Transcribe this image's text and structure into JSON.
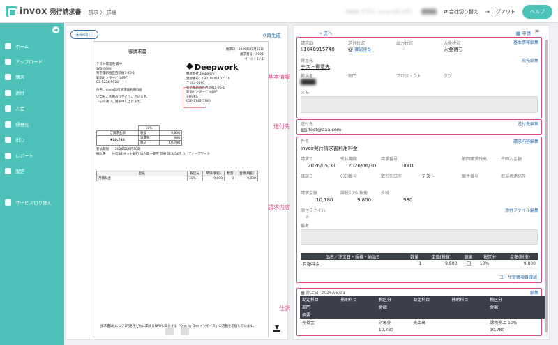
{
  "header": {
    "logo": "invox",
    "app_name": "発行請求書",
    "breadcrumb_root": "請求",
    "breadcrumb_sep": "〉",
    "breadcrumb_current": "詳細",
    "company_blur": "invox アプリ（ショッピング）",
    "user_blur": "████",
    "switch_company": "会社切り替え",
    "logout": "ログアウト",
    "help": "ヘルプ"
  },
  "sidebar": {
    "items": [
      {
        "label": "ホーム",
        "icon": "home-icon"
      },
      {
        "label": "アップロード",
        "icon": "upload-icon"
      },
      {
        "label": "請求",
        "icon": "invoice-icon"
      },
      {
        "label": "送付",
        "icon": "send-icon"
      },
      {
        "label": "入金",
        "icon": "deposit-icon"
      },
      {
        "label": "得意先",
        "icon": "client-icon"
      },
      {
        "label": "出力",
        "icon": "output-icon"
      },
      {
        "label": "レポート",
        "icon": "report-icon"
      },
      {
        "label": "設定",
        "icon": "settings-icon"
      },
      {
        "label": "サービス切り替え",
        "icon": "switch-icon"
      }
    ]
  },
  "doc": {
    "status_badge": "未申請",
    "regen": "再生成",
    "paper": {
      "title": "御請求書",
      "date": "請求日：2026年05月31日",
      "number": "請求番号：0001",
      "page": "ページ：1 / 1",
      "to": "テスト得意先 御中",
      "to_zip": "163-0690",
      "to_addr1": "東京都新宿区西新宿1-25-1",
      "to_addr2": "新宿センタービル49F",
      "to_tel": "03-1234-5678",
      "subject": "件名：invox発行請求書利用料金",
      "greet1": "いつもご利用ありがとうございます。",
      "greet2": "下記の通りご請求申し上げます。",
      "logo": "Deepwork",
      "co_name": "株式会社Deepwork",
      "co_reg": "登録番号：T9010401102110",
      "co_zip": "〒163-0690",
      "co_addr": "東京都新宿区西新宿1-25-1",
      "co_bldg": "新宿センタービル49F",
      "co_more": "+OURS",
      "co_tel": "050-1742-5780",
      "sum_rate": "10%",
      "sum_label": "ご請求金額",
      "sum_total": "¥10,780",
      "row_taxex": "税抜",
      "row_taxex_v": "9,800",
      "row_tax": "消費税",
      "row_tax_v": "980",
      "row_taxin": "税込",
      "row_taxin_v": "10,780",
      "pay_due": "支払期限　　2026年06月30日",
      "bank": "振込先　　住信SBIネット銀行 法人第一支店 普通 1134567 カ）ディープワーク",
      "h_item": "品名",
      "h_rate": "税区分",
      "h_unit": "単価(税抜)",
      "h_qty": "数量",
      "h_amount": "金額(税抜)",
      "item_name": "月額料金",
      "item_rate": "10%",
      "item_unit": "9,800",
      "item_qty": "1",
      "item_amount": "9,800",
      "footer": "請求書1枚につき1円を子どもに関するNPOに寄付する「One by One インボイス」の活動を応援しています。"
    }
  },
  "callouts": {
    "basic": "基本情報",
    "send": "送付先",
    "content": "請求内容",
    "journal": "仕訳"
  },
  "info": {
    "next": "→ 次へ",
    "print": "申請",
    "menu": "☰",
    "basic": {
      "edit": "基本情報編集",
      "no_label": "請求ID",
      "no": "II1048915748",
      "send_status_label": "送付状況",
      "send_status": "確認待ち",
      "out_status_label": "出力状況",
      "deposit_label": "入金状況",
      "deposit": "入金待ち",
      "client_label": "得意先",
      "client": "テスト得意先",
      "client_edit": "宛先編集",
      "owner_label": "担当者",
      "owner": "████",
      "dept_label": "部門",
      "project_label": "プロジェクト",
      "tag_label": "タグ",
      "memo_label": "メモ"
    },
    "send": {
      "label": "送付先",
      "edit": "送付先編集",
      "chip": "To",
      "email": "test@aaa.com"
    },
    "content": {
      "edit": "請求内容編集",
      "subject_label": "件名",
      "subject": "invox発行請求書利用料金",
      "date_label": "請求日",
      "date": "2026/05/31",
      "due_label": "支払期限",
      "due": "2026/06/30",
      "no_label": "請求番号",
      "no": "0001",
      "prev_label": "前回請求残高",
      "this_label": "今回入金額",
      "confirm_label": "確認日",
      "oo_label": "〇〇番号",
      "acct_label": "取引先口座",
      "acct": "テスト",
      "case_label": "案件番号",
      "contact_label": "担当者連絡先",
      "amt_label": "請求金額",
      "amt": "10,780",
      "tax10_label": "課税10% 税抜",
      "tax10": "9,800",
      "taxout_label": "外税",
      "taxout": "980",
      "attach_label": "添付ファイル",
      "attach_edit": "添付ファイル編集",
      "note_label": "備考",
      "th_item": "品名／注文日・規格・納品日",
      "th_qty": "数量",
      "th_unit": "単価(税抜)",
      "th_src": "源泉",
      "th_rate": "税区分",
      "th_amount": "金額(税抜)",
      "item": "月額料金",
      "qty": "1",
      "unit": "9,800",
      "rate": "10%",
      "amount": "9,800",
      "link": "ユーザ定義項目確認"
    },
    "journal": {
      "date_label": "計上日",
      "date": "2026/05/31",
      "edit": "編集",
      "h_dacct": "勘定科目",
      "h_dsub": "補助科目",
      "h_dtax": "税区分",
      "h_cacct": "勘定科目",
      "h_csub": "補助科目",
      "h_ctax": "税区分",
      "h_dept": "部門",
      "h_amount": "金額",
      "h_amount2": "金額",
      "h_desc": "摘要",
      "d_acct": "売掛金",
      "d_tax": "対象外",
      "d_amt": "10,780",
      "c_acct": "売上高",
      "c_tax": "課税売上 10%",
      "c_amt": "10,780"
    }
  }
}
